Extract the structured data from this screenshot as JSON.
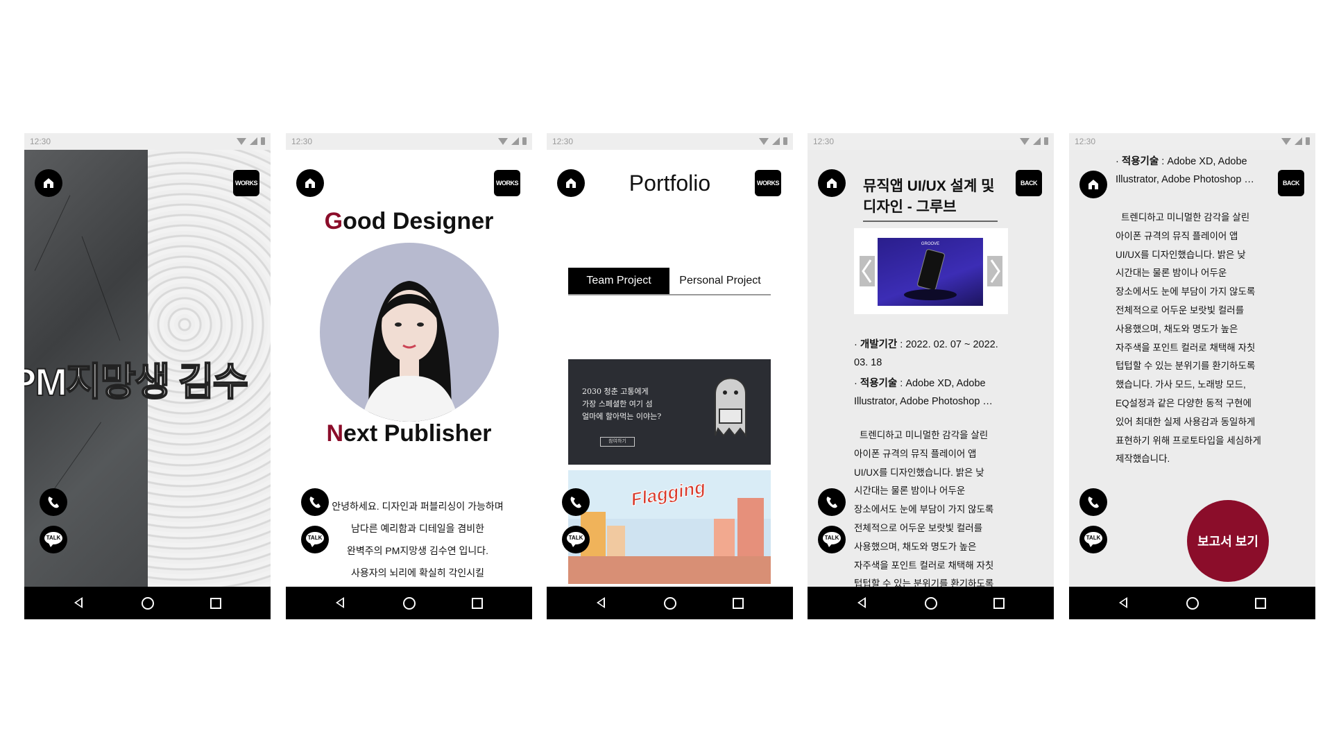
{
  "status": {
    "time": "12:30"
  },
  "buttons": {
    "works": "WORKS",
    "back": "BACK",
    "talk": "TALK"
  },
  "phone1": {
    "banner": "PM지망생 김수"
  },
  "phone2": {
    "heading1_first": "G",
    "heading1_rest": "ood Designer",
    "heading2_first": "N",
    "heading2_rest": "ext Publisher",
    "intro": [
      "안녕하세요. 디자인과 퍼블리싱이 가능하며",
      "남다른 예리함과 디테일을 겸비한",
      "완벽주의 PM지망생 김수연 입니다.",
      "사용자의 뇌리에 확실히 각인시킬"
    ]
  },
  "phone3": {
    "title": "Portfolio",
    "tabs": [
      "Team Project",
      "Personal Project"
    ],
    "thumb1": {
      "lines": [
        "2030 청춘 고통에게",
        "가장 스페셜한 여기 섬",
        "얼마에 할아먹는 이야는?"
      ],
      "button": "참여하기"
    },
    "thumb2": {
      "title": "Flagging"
    }
  },
  "phone4": {
    "title": "뮤직앱 UI/UX 설계 및 디자인 - 그루브",
    "carousel_label": "GROOVE",
    "period_label": "개발기간",
    "period_value": " : 2022. 02. 07 ~ 2022. 03. 18",
    "tools_label": "적용기술",
    "tools_value": " : Adobe XD, Adobe Illustrator, Adobe Photoshop …",
    "body": [
      "트렌디하고 미니멀한 감각을 살린",
      "아이폰 규격의 뮤직 플레이어 앱",
      "UI/UX를 디자인했습니다. 밝은 낮",
      "시간대는 물론 밤이나 어두운",
      "장소에서도 눈에 부담이 가지 않도록",
      "전체적으로 어두운 보랏빛 컬러를",
      "사용했으며, 채도와 명도가 높은",
      "자주색을 포인트 컬러로 채택해 자칫",
      "텁텁할 수 있는 분위기를 환기하도록"
    ]
  },
  "phone5": {
    "tools_label": "적용기술",
    "tools_value": " : Adobe XD, Adobe Illustrator, Adobe Photoshop …",
    "body": [
      "트렌디하고 미니멀한 감각을 살린",
      "아이폰 규격의 뮤직 플레이어 앱",
      "UI/UX를 디자인했습니다. 밝은 낮",
      "시간대는 물론 밤이나 어두운",
      "장소에서도 눈에 부담이 가지 않도록",
      "전체적으로 어두운 보랏빛 컬러를",
      "사용했으며, 채도와 명도가 높은",
      "자주색을 포인트 컬러로 채택해 자칫",
      "텁텁할 수 있는 분위기를 환기하도록",
      "했습니다. 가사 모드, 노래방 모드,",
      "EQ설정과 같은 다양한 동적 구현에",
      "있어 최대한 실제 사용감과 동일하게",
      "표현하기 위해 프로토타입을 세심하게",
      "제작했습니다."
    ],
    "report_button": "보고서 보기"
  },
  "colors": {
    "accent": "#8b0d2a",
    "dark": "#000000",
    "panel": "#ececec"
  },
  "icons": [
    "home-icon",
    "phone-icon",
    "talk-icon",
    "back-nav-icon",
    "home-nav-icon",
    "recent-nav-icon",
    "wifi-icon",
    "signal-icon",
    "battery-icon"
  ]
}
